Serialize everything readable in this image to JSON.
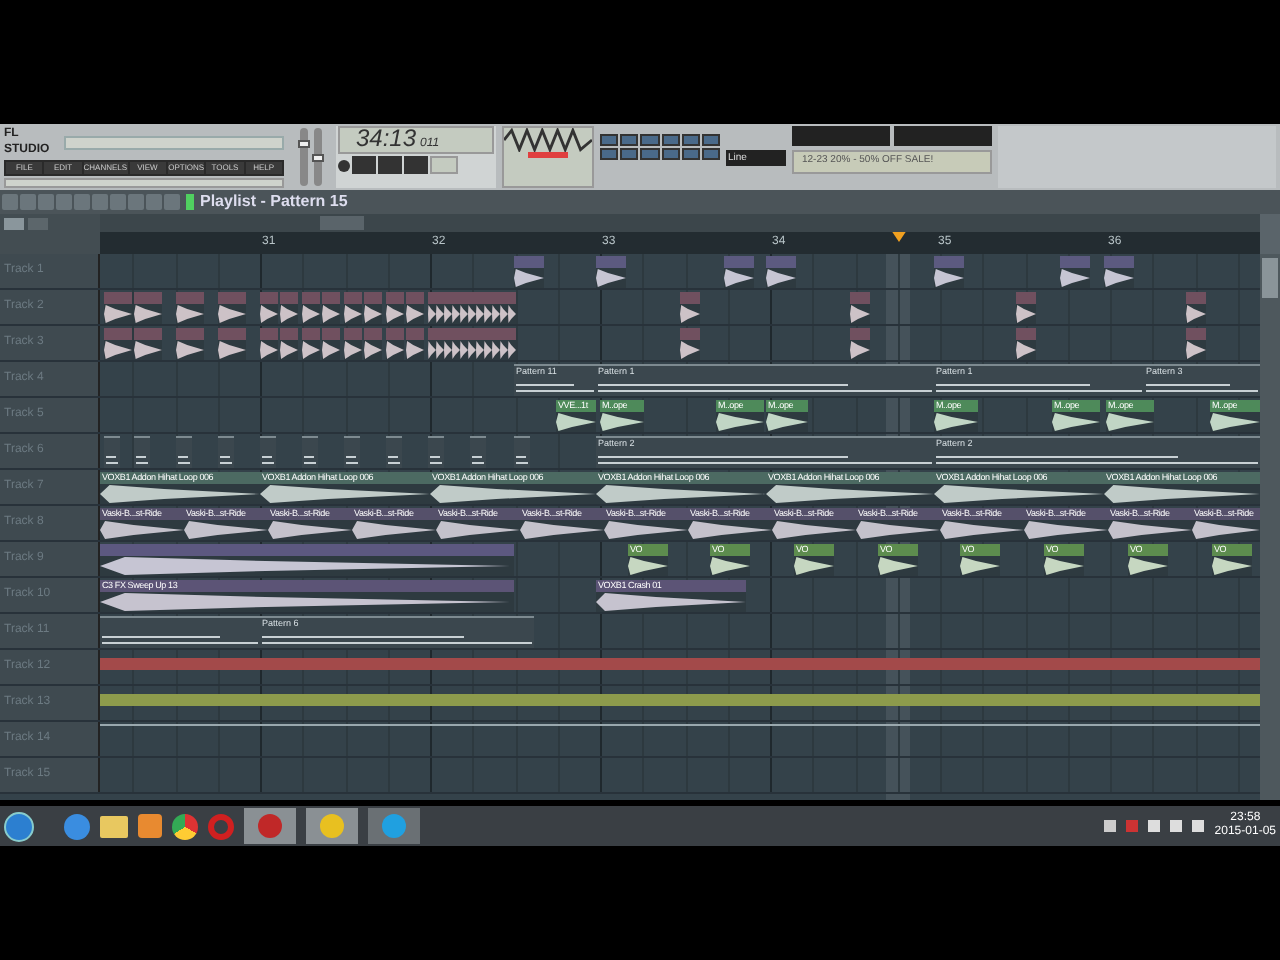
{
  "toolbar": {
    "logo": "FL STUDIO",
    "volume": {
      "level": 0.75
    },
    "pitch": {
      "level": 0.5
    },
    "menu": [
      "FILE",
      "EDIT",
      "CHANNELS",
      "VIEW",
      "OPTIONS",
      "TOOLS",
      "HELP"
    ],
    "time": "34:13",
    "time_small": "011",
    "snap": "Line",
    "news": "12-23 20% - 50% OFF SALE!"
  },
  "playlist": {
    "title": "Playlist - Pattern 15",
    "ruler": [
      "31",
      "32",
      "33",
      "34",
      "35",
      "36"
    ],
    "tracks": [
      {
        "name": "Track 1",
        "color": "#5c5a80",
        "clips": [
          {
            "kind": "audio"
          },
          {
            "kind": "audio"
          },
          {
            "kind": "audio"
          },
          {
            "kind": "audio"
          },
          {
            "kind": "audio"
          },
          {
            "kind": "audio"
          },
          {
            "kind": "audio"
          }
        ]
      },
      {
        "name": "Track 2",
        "color": "#70505f",
        "clips": [
          {
            "kind": "audio"
          },
          {
            "kind": "audio"
          },
          {
            "kind": "audio"
          },
          {
            "kind": "audio"
          },
          {
            "kind": "audio"
          },
          {
            "kind": "audio"
          },
          {
            "kind": "audio"
          },
          {
            "kind": "audio"
          },
          {
            "kind": "audio"
          },
          {
            "kind": "audio"
          },
          {
            "kind": "audio"
          },
          {
            "kind": "audio"
          },
          {
            "kind": "audio"
          },
          {
            "kind": "audio"
          },
          {
            "kind": "audio"
          },
          {
            "kind": "audio"
          },
          {
            "kind": "audio"
          },
          {
            "kind": "audio"
          },
          {
            "kind": "audio"
          },
          {
            "kind": "audio"
          },
          {
            "kind": "audio"
          },
          {
            "kind": "audio"
          },
          {
            "kind": "audio"
          },
          {
            "kind": "audio"
          },
          {
            "kind": "audio"
          },
          {
            "kind": "audio"
          },
          {
            "kind": "audio"
          }
        ]
      },
      {
        "name": "Track 3",
        "color": "#70505f",
        "clips": [
          {
            "kind": "audio"
          },
          {
            "kind": "audio"
          },
          {
            "kind": "audio"
          },
          {
            "kind": "audio"
          },
          {
            "kind": "audio"
          },
          {
            "kind": "audio"
          },
          {
            "kind": "audio"
          },
          {
            "kind": "audio"
          },
          {
            "kind": "audio"
          },
          {
            "kind": "audio"
          },
          {
            "kind": "audio"
          },
          {
            "kind": "audio"
          },
          {
            "kind": "audio"
          },
          {
            "kind": "audio"
          },
          {
            "kind": "audio"
          },
          {
            "kind": "audio"
          },
          {
            "kind": "audio"
          },
          {
            "kind": "audio"
          },
          {
            "kind": "audio"
          },
          {
            "kind": "audio"
          },
          {
            "kind": "audio"
          },
          {
            "kind": "audio"
          },
          {
            "kind": "audio"
          },
          {
            "kind": "audio"
          },
          {
            "kind": "audio"
          },
          {
            "kind": "audio"
          },
          {
            "kind": "audio"
          }
        ]
      },
      {
        "name": "Track 4",
        "color": "#3b474e",
        "clips": [
          {
            "kind": "pattern",
            "label": "Pattern 11"
          },
          {
            "kind": "pattern",
            "label": "Pattern 1"
          },
          {
            "kind": "pattern",
            "label": "Pattern 1"
          },
          {
            "kind": "pattern",
            "label": "Pattern 3"
          }
        ]
      },
      {
        "name": "Track 5",
        "color": "#4e8a5a",
        "clips": [
          {
            "kind": "audio",
            "label": "VVE...1t"
          },
          {
            "kind": "audio",
            "label": "M..ope"
          },
          {
            "kind": "audio",
            "label": "M..ope"
          },
          {
            "kind": "audio",
            "label": "M..ope"
          },
          {
            "kind": "audio",
            "label": "M..ope"
          },
          {
            "kind": "audio",
            "label": "M..ope"
          },
          {
            "kind": "audio",
            "label": "M..ope"
          },
          {
            "kind": "audio",
            "label": "M..ope"
          }
        ]
      },
      {
        "name": "Track 6",
        "color": "#3b474e",
        "clips": [
          {
            "kind": "pattern"
          },
          {
            "kind": "pattern"
          },
          {
            "kind": "pattern"
          },
          {
            "kind": "pattern"
          },
          {
            "kind": "pattern"
          },
          {
            "kind": "pattern"
          },
          {
            "kind": "pattern"
          },
          {
            "kind": "pattern"
          },
          {
            "kind": "pattern"
          },
          {
            "kind": "pattern"
          },
          {
            "kind": "pattern"
          },
          {
            "kind": "pattern",
            "label": "Pattern 2"
          },
          {
            "kind": "pattern",
            "label": "Pattern 2"
          }
        ]
      },
      {
        "name": "Track 7",
        "color": "#4c6a62",
        "clips": [
          {
            "kind": "audio",
            "label": "VOXB1 Addon Hihat Loop 006"
          },
          {
            "kind": "audio",
            "label": "VOXB1 Addon Hihat Loop 006"
          },
          {
            "kind": "audio",
            "label": "VOXB1 Addon Hihat Loop 006"
          },
          {
            "kind": "audio",
            "label": "VOXB1 Addon Hihat Loop 006"
          },
          {
            "kind": "audio",
            "label": "VOXB1 Addon Hihat Loop 006"
          },
          {
            "kind": "audio",
            "label": "VOXB1 Addon Hihat Loop 006"
          },
          {
            "kind": "audio",
            "label": "VOXB1 Addon Hihat Loop 006"
          }
        ]
      },
      {
        "name": "Track 8",
        "color": "#55506a",
        "clips": [
          {
            "kind": "audio",
            "label": "Vaski-B...st-Ride"
          },
          {
            "kind": "audio",
            "label": "Vaski-B...st-Ride"
          },
          {
            "kind": "audio",
            "label": "Vaski-B...st-Ride"
          },
          {
            "kind": "audio",
            "label": "Vaski-B...st-Ride"
          },
          {
            "kind": "audio",
            "label": "Vaski-B...st-Ride"
          },
          {
            "kind": "audio",
            "label": "Vaski-B...st-Ride"
          },
          {
            "kind": "audio",
            "label": "Vaski-B...st-Ride"
          },
          {
            "kind": "audio",
            "label": "Vaski-B...st-Ride"
          },
          {
            "kind": "audio",
            "label": "Vaski-B...st-Ride"
          },
          {
            "kind": "audio",
            "label": "Vaski-B...st-Ride"
          },
          {
            "kind": "audio",
            "label": "Vaski-B...st-Ride"
          },
          {
            "kind": "audio",
            "label": "Vaski-B...st-Ride"
          },
          {
            "kind": "audio",
            "label": "Vaski-B...st-Ride"
          },
          {
            "kind": "audio",
            "label": "Vaski-B...st-Ride"
          }
        ]
      },
      {
        "name": "Track 9",
        "color": "#5c5880",
        "clips": [
          {
            "kind": "audio"
          },
          {
            "kind": "audio",
            "label": "VO",
            "color": "#5d8c4e"
          },
          {
            "kind": "audio",
            "label": "VO",
            "color": "#5d8c4e"
          },
          {
            "kind": "audio",
            "label": "VO",
            "color": "#5d8c4e"
          },
          {
            "kind": "audio",
            "label": "VO",
            "color": "#5d8c4e"
          },
          {
            "kind": "audio",
            "label": "VO",
            "color": "#5d8c4e"
          },
          {
            "kind": "audio",
            "label": "VO",
            "color": "#5d8c4e"
          },
          {
            "kind": "audio",
            "label": "VO",
            "color": "#5d8c4e"
          },
          {
            "kind": "audio",
            "label": "VO",
            "color": "#5d8c4e"
          }
        ]
      },
      {
        "name": "Track 10",
        "color": "#5c5476",
        "clips": [
          {
            "kind": "audio",
            "label": "C3 FX Sweep Up 13"
          },
          {
            "kind": "audio",
            "label": "VOXB1 Crash 01"
          }
        ]
      },
      {
        "name": "Track 11",
        "color": "#3b474e",
        "clips": [
          {
            "kind": "pattern"
          },
          {
            "kind": "pattern",
            "label": "Pattern 6"
          }
        ]
      },
      {
        "name": "Track 12",
        "color": "#a34a4a",
        "clips": [
          {
            "kind": "bar"
          }
        ]
      },
      {
        "name": "Track 13",
        "color": "#8d9b4c",
        "clips": [
          {
            "kind": "bar"
          }
        ]
      },
      {
        "name": "Track 14",
        "color": "#9aa8ae",
        "clips": [
          {
            "kind": "line"
          }
        ]
      },
      {
        "name": "Track 15"
      }
    ]
  },
  "taskbar": {
    "clock": "23:58",
    "date": "2015-01-05"
  }
}
